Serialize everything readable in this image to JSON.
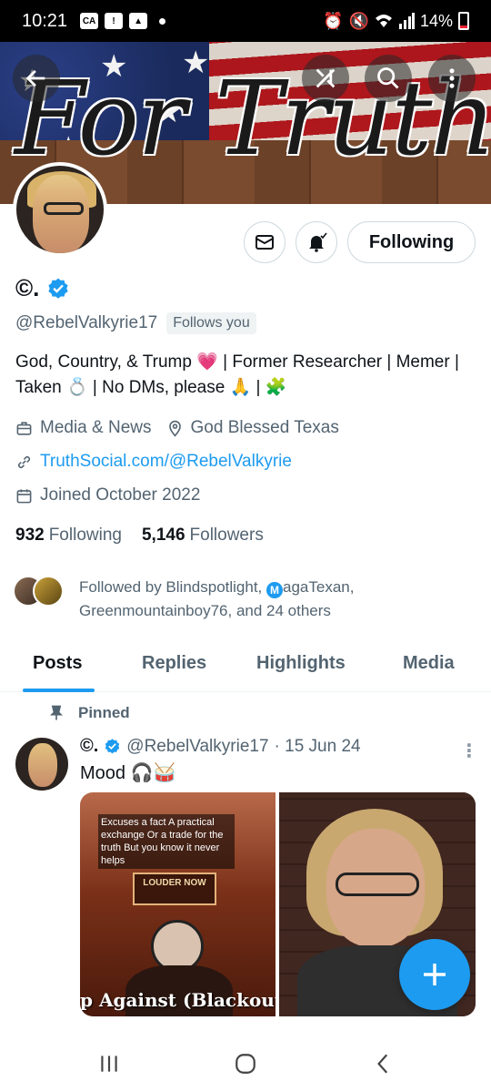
{
  "status_bar": {
    "time": "10:21",
    "battery": "14%",
    "icons": [
      "carrier-icon",
      "alert-icon",
      "image-icon",
      "dot-icon",
      "alarm-icon",
      "mute-icon",
      "wifi-icon",
      "signal-icon",
      "battery-icon"
    ]
  },
  "banner": {
    "title": "For Truth",
    "actions": [
      "back-arrow-icon",
      "grok-icon",
      "search-icon",
      "more-icon"
    ]
  },
  "profile": {
    "display_name": "©.",
    "handle": "@RebelValkyrie17",
    "follows_you": "Follows you",
    "bio": "God, Country, & Trump 💗 | Former Researcher | Memer | Taken 💍 | No DMs, please 🙏 | 🧩",
    "category": "Media & News",
    "location": "God Blessed Texas",
    "website": "TruthSocial.com/@RebelValkyrie",
    "joined": "Joined October 2022",
    "following_count": "932",
    "following_label": "Following",
    "followers_count": "5,146",
    "followers_label": "Followers",
    "followed_by_prefix": "Followed by Blindspotlight,",
    "followed_by_badge": "M",
    "followed_by_rest": "agaTexan, Greenmountainboy76, and 24 others",
    "verified_color": "#1d9bf0"
  },
  "actions": {
    "following_button": "Following"
  },
  "tabs": [
    {
      "label": "Posts",
      "active": true
    },
    {
      "label": "Replies",
      "active": false
    },
    {
      "label": "Highlights",
      "active": false
    },
    {
      "label": "Media",
      "active": false
    }
  ],
  "pinned_post": {
    "pinned_label": "Pinned",
    "author_name": "©.",
    "author_handle": "@RebelValkyrie17",
    "date": "· 15 Jun 24",
    "text": "Mood 🎧🥁",
    "media_1": {
      "caption": "Excuses a fact A practical exchange Or a trade for the truth But you know it never helps",
      "sign": "LOUDER NOW",
      "subtitle": "p Against (Blackout"
    }
  },
  "colors": {
    "accent": "#1d9bf0",
    "text_primary": "#0f1419",
    "text_secondary": "#536471"
  }
}
